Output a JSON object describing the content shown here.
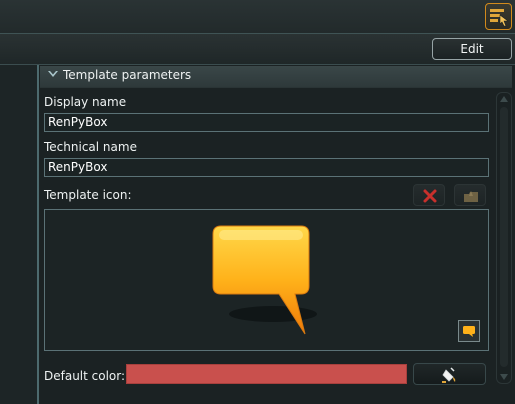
{
  "toolbar": {
    "edit_label": "Edit"
  },
  "section": {
    "title": "Template parameters"
  },
  "fields": {
    "display_name": {
      "label": "Display name",
      "value": "RenPyBox"
    },
    "technical_name": {
      "label": "Technical name",
      "value": "RenPyBox"
    }
  },
  "template_icon": {
    "label": "Template icon:",
    "icon": "speech-bubble-icon"
  },
  "default_color": {
    "label": "Default color:",
    "value": "#c9504d"
  },
  "icons": {
    "corner": "panel-toggle-icon",
    "remove": "x-icon",
    "open": "folder-icon",
    "picker": "color-bucket-icon"
  }
}
